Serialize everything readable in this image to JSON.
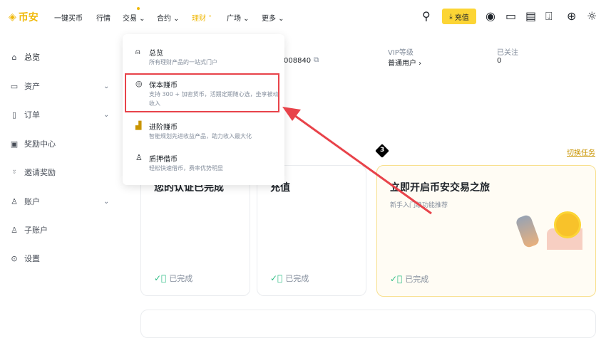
{
  "nav": {
    "logo": "币安",
    "items": [
      "一键买币",
      "行情",
      "交易",
      "合约",
      "理财",
      "广场",
      "更多"
    ],
    "deposit": "充值"
  },
  "sidebar": {
    "items": [
      {
        "label": "总览",
        "icon": "home-icon"
      },
      {
        "label": "资产",
        "icon": "wallet-icon"
      },
      {
        "label": "订单",
        "icon": "order-icon"
      },
      {
        "label": "奖励中心",
        "icon": "reward-icon"
      },
      {
        "label": "邀请奖励",
        "icon": "invite-icon"
      },
      {
        "label": "账户",
        "icon": "user-icon"
      },
      {
        "label": "子账户",
        "icon": "subaccount-icon"
      },
      {
        "label": "设置",
        "icon": "settings-icon"
      }
    ]
  },
  "menu": {
    "items": [
      {
        "title": "总览",
        "desc": "所有理财产品的一站式门户"
      },
      {
        "title": "保本赚币",
        "desc": "支持 300 + 加密货币，活期定期随心选，坐享被动收入"
      },
      {
        "title": "进阶赚币",
        "desc": "智能规划先进收益产品，助力收入最大化"
      },
      {
        "title": "质押借币",
        "desc": "轻松快速借币，费率优势明显"
      }
    ]
  },
  "profile": {
    "uid": "008840",
    "vip_label": "VIP等级",
    "vip_value": "普通用户 ›",
    "follow_label": "已关注",
    "follow_value": "0"
  },
  "tasks": {
    "step": "3",
    "switch": "切换任务",
    "cards": [
      {
        "title": "您的认证已完成",
        "status": "已完成"
      },
      {
        "title": "充值",
        "status": "已完成"
      },
      {
        "title": "立即开启币安交易之旅",
        "subtitle": "新手入门级功能推荐",
        "status": "已完成"
      }
    ]
  },
  "colors": {
    "brand": "#f0b90b",
    "annotation": "#e8434a",
    "success": "#2ebd85"
  }
}
